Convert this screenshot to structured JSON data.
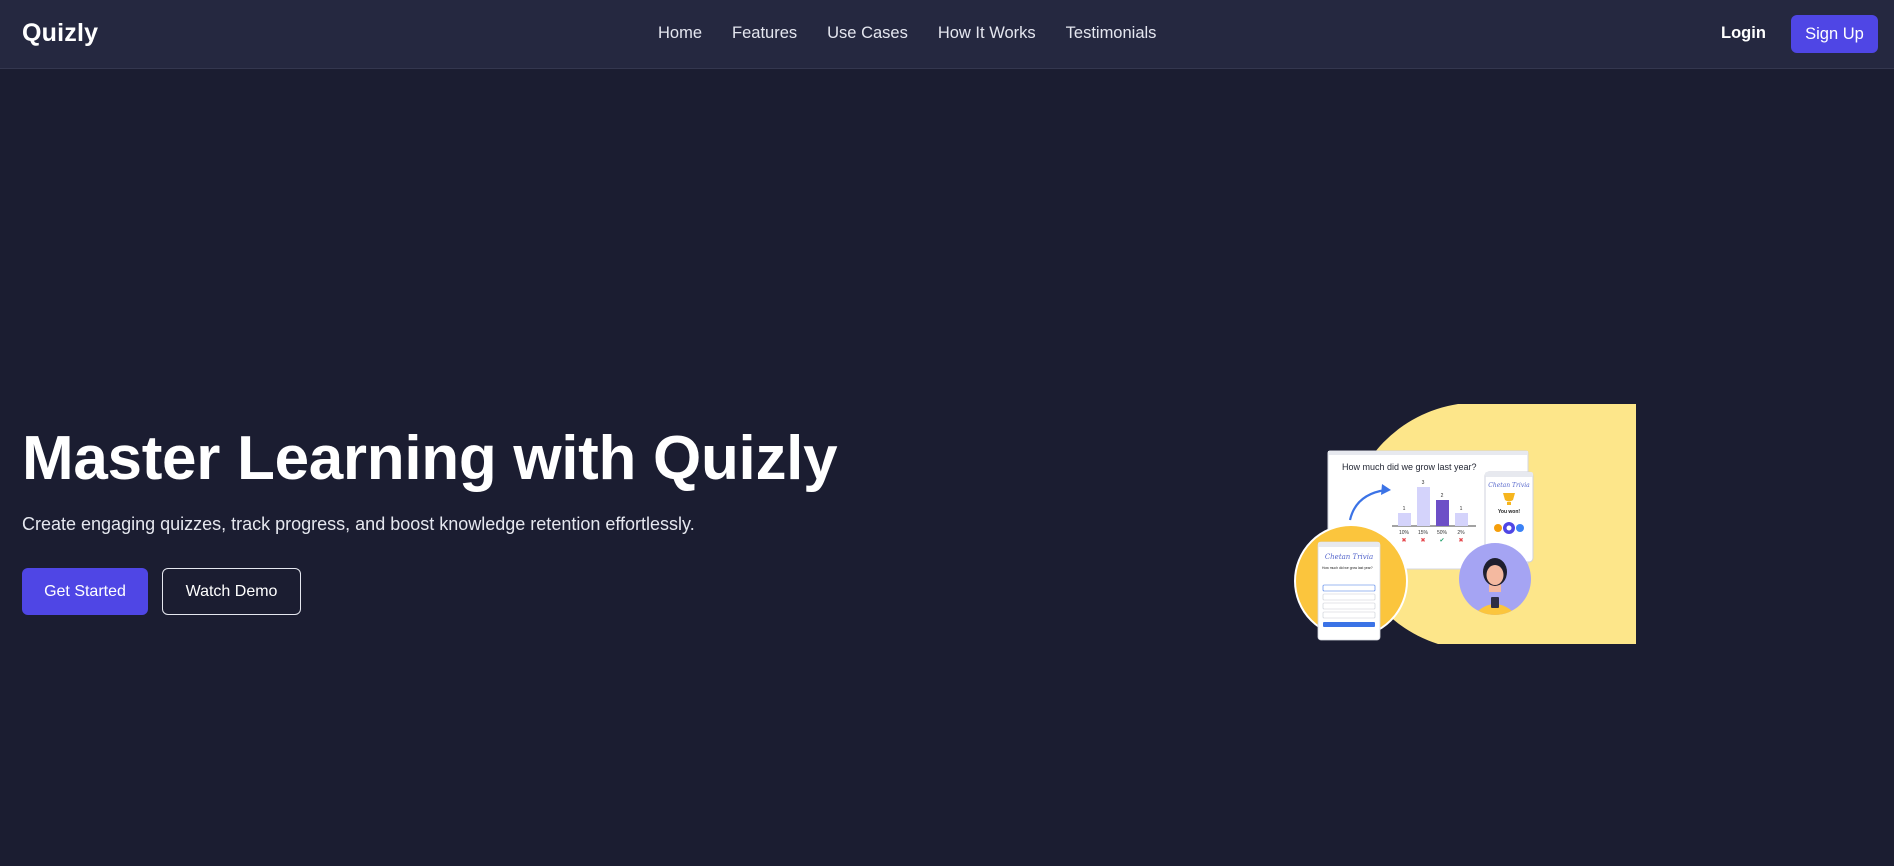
{
  "nav": {
    "brand": "Quizly",
    "links": [
      "Home",
      "Features",
      "Use Cases",
      "How It Works",
      "Testimonials"
    ],
    "login": "Login",
    "signup": "Sign Up"
  },
  "hero": {
    "title": "Master Learning with Quizly",
    "subtitle": "Create engaging quizzes, track progress, and boost knowledge retention effortlessly.",
    "primary_cta": "Get Started",
    "secondary_cta": "Watch Demo"
  },
  "illustration": {
    "question": "How much did we grow last year?",
    "app_name": "Chetan Trivia",
    "phone_question": "How much did we grow last year?",
    "result_text": "You won!",
    "bar_labels": [
      "10%",
      "15%",
      "50%",
      "2%"
    ],
    "bar_counts": [
      "1",
      "3",
      "2",
      "1"
    ]
  },
  "colors": {
    "background": "#1b1d31",
    "navbar": "#252840",
    "accent": "#4f46e5",
    "illustration_yellow": "#fde68a",
    "circle_yellow": "#fbc53d",
    "circle_lilac": "#a5a4f3",
    "bar_purple": "#6d4fc7"
  }
}
